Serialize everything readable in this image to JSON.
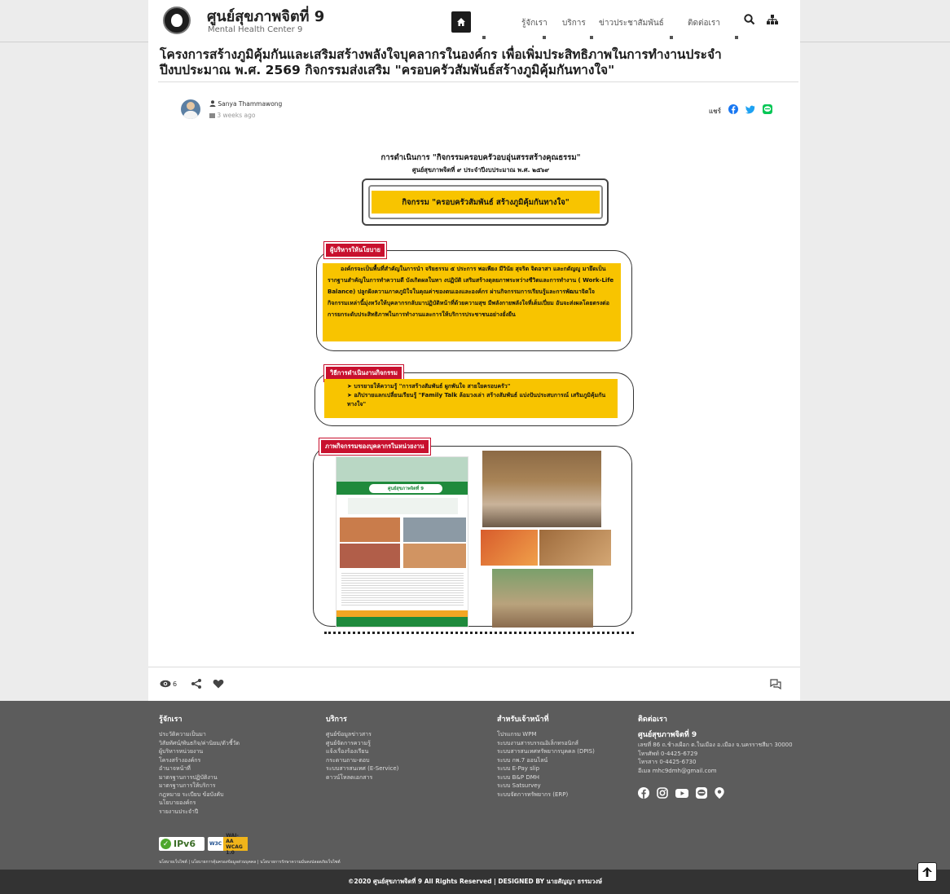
{
  "header": {
    "brand_title": "ศูนย์สุขภาพจิตที่ 9",
    "brand_subtitle": "Mental Health Center 9",
    "nav": [
      "รู้จักเรา",
      "บริการ",
      "ข่าวประชาสัมพันธ์",
      "ติดต่อเรา"
    ]
  },
  "post": {
    "title": "โครงการสร้างภูมิคุ้มกันและเสริมสร้างพลังใจบุคลากรในองค์กร เพื่อเพิ่มประสิทธิภาพในการทำงานประจำปีงบประมาณ พ.ศ. 2569 กิจกรรมส่งเสริม \"ครอบครัวสัมพันธ์สร้างภูมิคุ้มกันทางใจ\"",
    "author": "Sanya Thammawong",
    "date": "3 weeks ago",
    "share_label": "แชร์",
    "views": "6"
  },
  "article": {
    "heading": "การดำเนินการ \"กิจกรรมครอบครัวอบอุ่นสรรสร้างคุณธรรม\"",
    "subheading": "ศูนย์สุขภาพจิตที่ ๙ ประจำปีงบประมาณ พ.ศ. ๒๕๖๙",
    "banner": "กิจกรรม \"ครอบครัวสัมพันธ์ สร้างภูมิคุ้มกันทางใจ\"",
    "policy_tag": "ผู้บริหารให้นโยบาย",
    "policy_text": "องค์กรจะเป็นพื้นที่สำคัญในการนำ จริยธรรม ๕ ประการ พอเพียง มีวินัย สุจริต จิตอาสา และกตัญญู มายึดเป็น รากฐานสำคัญในการทำความดี บังเกิดผลในทา งปฏิบัติ เสริมสร้างดุลยภาพระหว่างชีวิตและการทำงาน ( Work-Life Balance) ปลูกฝังความภาคภูมิใจในคุณค่าของตนเองและองค์กร ผ่านกิจกรรมการเรียนรู้และการพัฒนาจิตใจ กิจกรรมเหล่านี้มุ่งหวังให้บุคลากรกลับมาปฏิบัติหน้าที่ด้วยความสุข มีพลังกายพลังใจที่เต็มเปี่ยม อันจะส่งผลโดยตรงต่อการยกระดับประสิทธิภาพในการทำงานและการให้บริการประชาชนอย่างยั่งยืน",
    "method_tag": "วิธีการดำเนินงานกิจกรรม",
    "method_items": [
      "บรรยายให้ความรู้ \"การสร้างสัมพันธ์ ผูกพันใจ สายใยครอบครัว\"",
      "อภิปรายแลกเปลี่ยนเรียนรู้ \"Family Talk ล้อมวงเล่า สร้างสัมพันธ์ แบ่งปันประสบการณ์ เสริมภูมิคุ้มกันทางใจ\""
    ],
    "photos_tag": "ภาพกิจกรรมของบุคลากรในหน่วยงาน",
    "poster_logo": "ศูนย์สุขภาพจิตที่ 9"
  },
  "footer": {
    "col1": {
      "title": "รู้จักเรา",
      "links": [
        "ประวัติความเป็นมา",
        "วิสัยทัศน์/พันธกิจ/ค่านิยม/ตัวชี้วัด",
        "ผู้บริหารหน่วยงาน",
        "โครงสร้างองค์กร",
        "อำนาจหน้าที่",
        "มาตรฐานการปฏิบัติงาน",
        "มาตรฐานการให้บริการ",
        "กฎหมาย ระเบียบ ข้อบังคับ",
        "นโยบายองค์กร",
        "รายงานประจำปี"
      ]
    },
    "col2": {
      "title": "บริการ",
      "links": [
        "ศูนย์ข้อมูลข่าวสาร",
        "ศูนย์จัดการความรู้",
        "แจ้งเรื่องร้องเรียน",
        "กระดานถาม-ตอบ",
        "ระบบสารสนเทศ (E-Service)",
        "ดาวน์โหลดเอกสาร"
      ]
    },
    "col3": {
      "title": "สำหรับเจ้าหน้าที่",
      "links": [
        "โปรแกรม WPM",
        "ระบบงานสารบรรณอิเล็กทรอนิกส์",
        "ระบบสารสนเทศทรัพยากรบุคคล (DPIS)",
        "ระบบ กพ.7 ออนไลน์",
        "ระบบ E-Pay slip",
        "ระบบ B&P DMH",
        "ระบบ Satsurvey",
        "ระบบจัดการทรัพยากร (ERP)"
      ]
    },
    "col4": {
      "title": "ติดต่อเรา",
      "org": "ศูนย์สุขภาพจิตที่ 9",
      "address": "เลขที่ 86 ถ.ช้างเผือก ต.ในเมือง อ.เมือง จ.นครราชสีมา 30000",
      "phone": "โทรศัพท์ 0-4425-6729",
      "fax": "โทรสาร 0-4425-6730",
      "email": "อีเมล mhc9dmh@gmail.com"
    },
    "badge_ipv6": "IPv6",
    "badge_w3c": "W3C",
    "badge_wai": "WAI-AA",
    "badge_wcag": "WCAG 1.0",
    "policy_links": "นโยบายเว็บไซต์  |  นโยบายการคุ้มครองข้อมูลส่วนบุคคล  |  นโยบายการรักษาความมั่นคงปลอดภัยเว็บไซต์",
    "copyright": "©2020 ศูนย์สุขภาพจิตที่ 9 All Rights Reserved | DESIGNED BY นายสัญญา ธรรมวงษ์"
  }
}
